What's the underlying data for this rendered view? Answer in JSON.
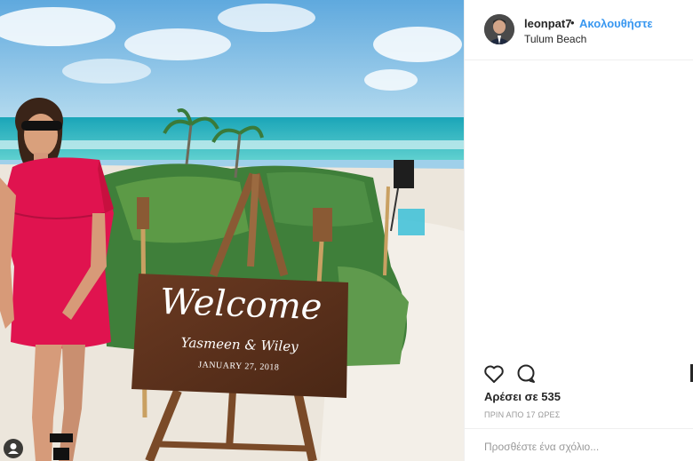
{
  "post": {
    "username": "leonpat7",
    "separator": "•",
    "follow_label": "Ακολουθήστε",
    "location": "Tulum Beach",
    "likes_text": "Αρέσει σε 535",
    "time_text": "ΠΡΙΝ ΑΠΟ 17 ΩΡΕΣ",
    "comment_placeholder": "Προσθέστε ένα σχόλιο..."
  },
  "sign": {
    "welcome": "Welcome",
    "names": "Yasmeen & Wiley",
    "date": "JANUARY 27, 2018"
  },
  "icons": {
    "like": "heart-icon",
    "comment": "comment-icon",
    "user_tag": "user-tag-icon"
  },
  "colors": {
    "link": "#3897f0",
    "text": "#262626",
    "muted": "#999999"
  }
}
